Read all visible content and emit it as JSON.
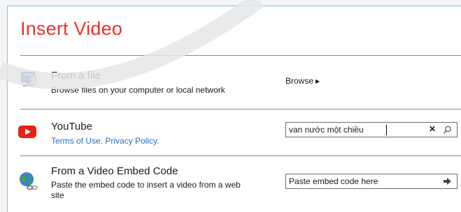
{
  "dialog": {
    "title": "Insert Video"
  },
  "file_option": {
    "icon": "computer-monitor-icon",
    "title": "From a file",
    "description": "Browse files on your computer or local network",
    "browse_label": "Browse"
  },
  "youtube_option": {
    "icon": "youtube-icon",
    "title": "YouTube",
    "terms_link": "Terms of Use.",
    "privacy_link": "Privacy Policy.",
    "search_value": "van nước một chiều",
    "clear_icon": "close-icon",
    "search_icon": "search-icon"
  },
  "embed_option": {
    "icon": "globe-link-icon",
    "title": "From a Video Embed Code",
    "description_line1": "Paste the embed code to insert a video from a web",
    "description_line2": "site",
    "placeholder": "Paste embed code here",
    "submit_icon": "arrow-right-icon"
  },
  "colors": {
    "title": "#e8332b",
    "link": "#2670b8",
    "youtube": "#e62117",
    "border": "#7fc3e6"
  }
}
